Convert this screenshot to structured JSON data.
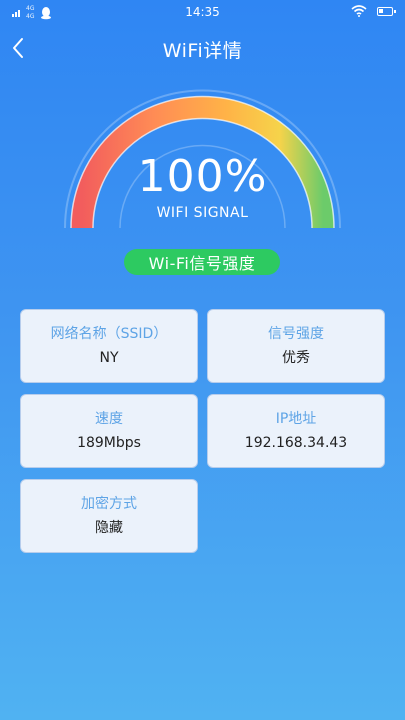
{
  "status_bar": {
    "network_lines": [
      "4G",
      "4G"
    ],
    "time": "14:35",
    "icons": [
      "signal-icon",
      "qq-icon",
      "wifi-icon",
      "battery-icon"
    ]
  },
  "header": {
    "title": "WiFi详情",
    "back_icon": "chevron-left-icon"
  },
  "gauge": {
    "value_text": "100%",
    "caption": "WIFI SIGNAL",
    "level": 1.0,
    "colors": [
      "#f25d5d",
      "#ff8c55",
      "#ffb347",
      "#f6d34a",
      "#6ccb6a"
    ]
  },
  "signal_label": "Wi-Fi信号强度",
  "cards": [
    {
      "label": "网络名称（SSID）",
      "value": "NY"
    },
    {
      "label": "信号强度",
      "value": "优秀"
    },
    {
      "label": "速度",
      "value": "189Mbps"
    },
    {
      "label": "IP地址",
      "value": "192.168.34.43"
    },
    {
      "label": "加密方式",
      "value": "隐藏"
    }
  ],
  "colors": {
    "background_top": "#2f86f3",
    "background_bottom": "#50b2f2",
    "pill": "#2dca61",
    "card_bg": "#ebf2fb",
    "card_label": "#5ea4e6"
  }
}
